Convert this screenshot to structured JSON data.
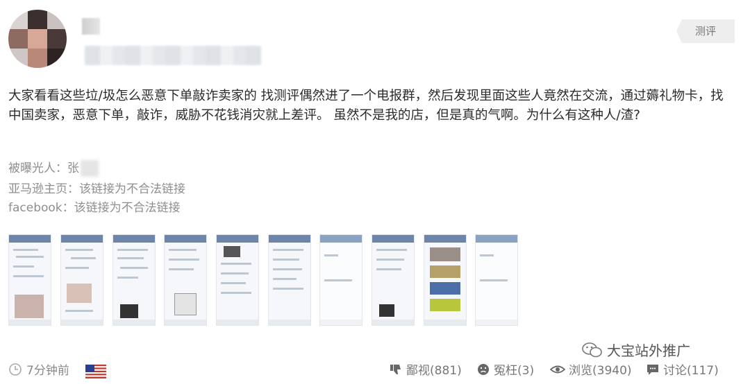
{
  "header": {
    "tag_label": "测评"
  },
  "post": {
    "body": "大家看看这些垃/圾怎么恶意下单敲诈卖家的 找测评偶然进了一个电报群，然后发现里面这些人竟然在交流，通过薅礼物卡，找中国卖家，恶意下单，敲诈，威胁不花钱消灾就上差评。 虽然不是我的店，但是真的气啊。为什么有这种人/渣?",
    "exposed_label": "被曝光人：张",
    "amazon_label": "亚马逊主页：该链接为不合法链接",
    "facebook_label": "facebook：该链接为不合法链接"
  },
  "footer": {
    "time": "7分钟前",
    "country_flag": "us-flag",
    "dislike": "鄙视(881)",
    "wronged": "冤枉(3)",
    "views": "浏览(3940)",
    "comments": "讨论(117)"
  },
  "watermark": "大宝站外推广",
  "colors": {
    "tag_bg": "#eeeeee",
    "chat_bar": "#6b86a8",
    "meta_text": "#8e8e8e"
  }
}
